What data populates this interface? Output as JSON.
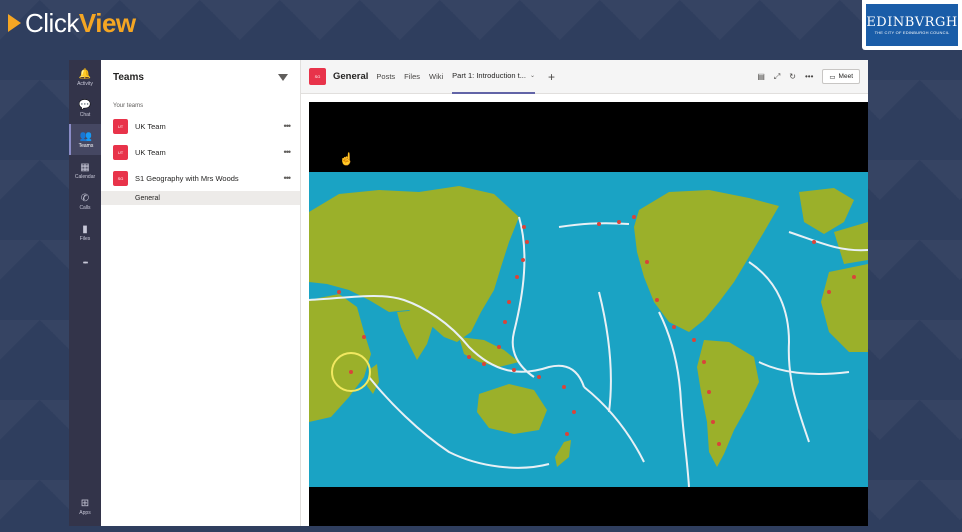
{
  "brand": {
    "logo_plain": "Click",
    "logo_bold": "View",
    "council_name": "EDINBVRGH",
    "council_sub": "THE CITY OF EDINBURGH COUNCIL"
  },
  "rail": {
    "items": [
      {
        "label": "Activity",
        "icon": "bell-icon",
        "glyph": "🔔"
      },
      {
        "label": "Chat",
        "icon": "chat-icon",
        "glyph": "💬"
      },
      {
        "label": "Teams",
        "icon": "teams-icon",
        "glyph": "👥"
      },
      {
        "label": "Calendar",
        "icon": "calendar-icon",
        "glyph": "▦"
      },
      {
        "label": "Calls",
        "icon": "phone-icon",
        "glyph": "✆"
      },
      {
        "label": "Files",
        "icon": "file-icon",
        "glyph": "▮"
      },
      {
        "label": "",
        "icon": "more-icon",
        "glyph": "•••"
      }
    ],
    "apps_label": "Apps",
    "apps_glyph": "⊞"
  },
  "teams_list": {
    "title": "Teams",
    "section": "Your teams",
    "teams": [
      {
        "name": "UK Team",
        "initials": "UT"
      },
      {
        "name": "UK Team",
        "initials": "UT"
      },
      {
        "name": "S1 Geography with Mrs Woods",
        "initials": "SG"
      }
    ],
    "channel": "General",
    "more_glyph": "•••"
  },
  "channel_header": {
    "title": "General",
    "initials": "SG",
    "tabs": [
      "Posts",
      "Files",
      "Wiki",
      "Part 1: Introduction t..."
    ],
    "add_tab": "+",
    "meet_label": "Meet"
  },
  "colors": {
    "ocean": "#1aa3c4",
    "land": "#9bb02a",
    "plate": "#e8f0f5",
    "volcano": "#d9443a",
    "accent": "#6264a7",
    "team_avatar": "#e8334a"
  }
}
